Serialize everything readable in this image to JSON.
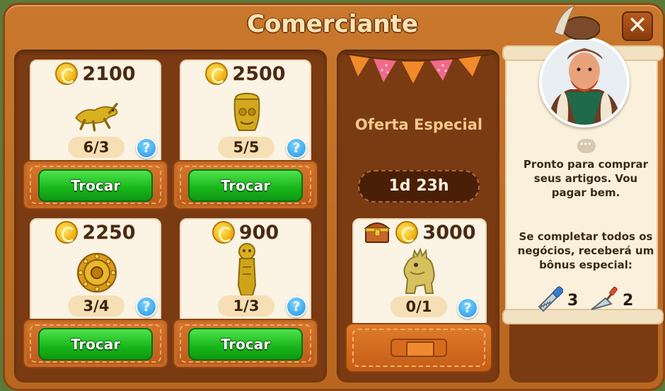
{
  "window": {
    "title": "Comerciante",
    "close_icon": "close-icon"
  },
  "trades": [
    {
      "price": "2100",
      "progress": "6/3",
      "item": "golden-lizard-figure",
      "button": "Trocar",
      "help": "?"
    },
    {
      "price": "2500",
      "progress": "5/5",
      "item": "golden-idol-head",
      "button": "Trocar",
      "help": "?"
    },
    {
      "price": "2250",
      "progress": "3/4",
      "item": "golden-sun-disc",
      "button": "Trocar",
      "help": "?"
    },
    {
      "price": "900",
      "progress": "1/3",
      "item": "golden-statuette",
      "button": "Trocar",
      "help": "?"
    }
  ],
  "special_offer": {
    "title": "Oferta Especial",
    "timer": "1d 23h",
    "price": "3000",
    "progress": "0/1",
    "item": "golden-dinosaur-statue",
    "help": "?"
  },
  "merchant": {
    "greeting": "Pronto para comprar seus artigos. Vou pagar bem.",
    "bonus_text": "Se completar todos os negócios, receberá um bônus especial:",
    "rewards": [
      {
        "icon": "saw-icon",
        "count": "3"
      },
      {
        "icon": "trowel-icon",
        "count": "2"
      }
    ]
  },
  "colors": {
    "frame": "#c9782d",
    "panel": "#7a3a12",
    "paper": "#fbf3e4",
    "trade_button": "#17b51a",
    "help_button": "#1f93e4",
    "coin": "#f2b514"
  }
}
